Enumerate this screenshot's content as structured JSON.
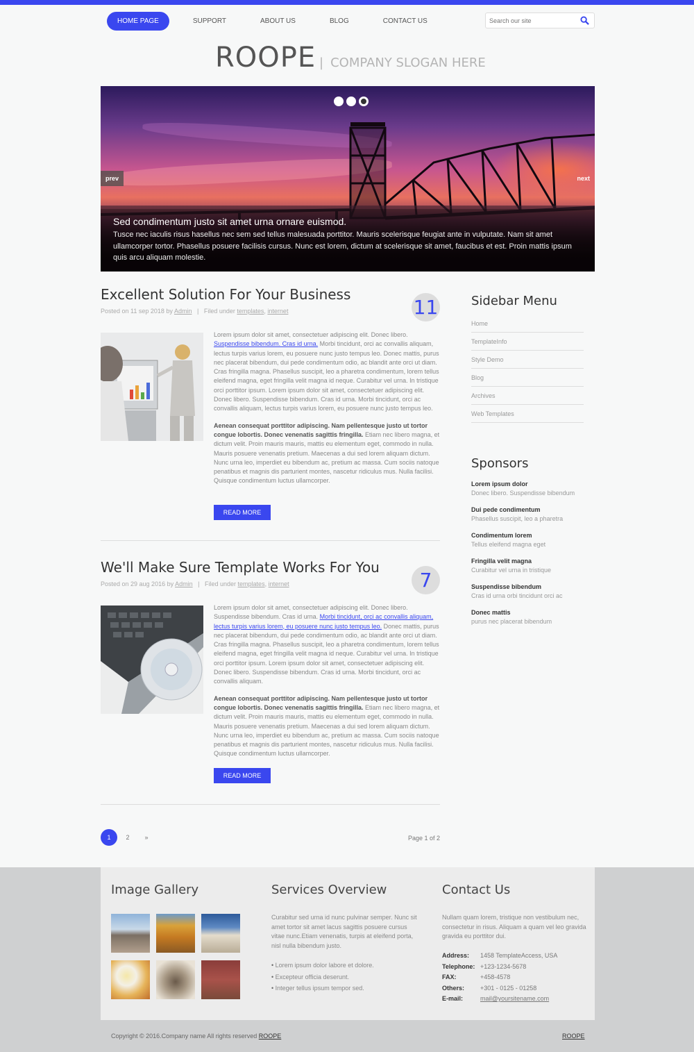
{
  "nav": {
    "items": [
      "HOME PAGE",
      "SUPPORT",
      "ABOUT US",
      "BLOG",
      "CONTACT US"
    ],
    "search_placeholder": "Search our site"
  },
  "header": {
    "logo": "ROOPE",
    "slogan": "COMPANY SLOGAN HERE"
  },
  "slider": {
    "prev": "prev",
    "next": "next",
    "caption_title": "Sed condimentum justo sit amet urna ornare euismod.",
    "caption_text": "Tusce nec iaculis risus hasellus nec sem sed tellus malesuada porttitor. Mauris scelerisque feugiat ante in vulputate. Nam sit amet ullamcorper tortor. Phasellus posuere facilisis cursus. Nunc est lorem, dictum at scelerisque sit amet, faucibus et est. Proin mattis ipsum quis arcu aliquam molestie."
  },
  "articles": [
    {
      "title": "Excellent Solution For Your Business",
      "count": "11",
      "posted": "Posted on 11 sep 2018 by",
      "author": "Admin",
      "filed": "Filed under",
      "tag1": "templates",
      "tag2": "internet",
      "p1a": "Lorem ipsum dolor sit amet, consectetuer adipiscing elit. Donec libero.",
      "p1link": "Suspendisse bibendum. Cras id urna.",
      "p1b": " Morbi tincidunt, orci ac convallis aliquam, lectus turpis varius lorem, eu posuere nunc justo tempus leo. Donec mattis, purus nec placerat bibendum, dui pede condimentum odio, ac blandit ante orci ut diam. Cras fringilla magna. Phasellus suscipit, leo a pharetra condimentum, lorem tellus eleifend magna, eget fringilla velit magna id neque. Curabitur vel urna. In tristique orci porttitor ipsum. Lorem ipsum dolor sit amet, consectetuer adipiscing elit. Donec libero. Suspendisse bibendum. Cras id urna. Morbi tincidunt, orci ac convallis aliquam, lectus turpis varius lorem, eu posuere nunc justo tempus leo.",
      "p2bold": "Aenean consequat porttitor adipiscing. Nam pellentesque justo ut tortor congue lobortis. Donec venenatis sagittis fringilla.",
      "p2": " Etiam nec libero magna, et dictum velit. Proin mauris mauris, mattis eu elementum eget, commodo in nulla. Mauris posuere venenatis pretium. Maecenas a dui sed lorem aliquam dictum. Nunc urna leo, imperdiet eu bibendum ac, pretium ac massa. Cum sociis natoque penatibus et magnis dis parturient montes, nascetur ridiculus mus. Nulla facilisi. Quisque condimentum luctus ullamcorper.",
      "read_more": "READ MORE"
    },
    {
      "title": "We'll Make Sure Template Works For You",
      "count": "7",
      "posted": "Posted on 29 aug 2016 by",
      "author": "Admin",
      "filed": "Filed under",
      "tag1": "templates",
      "tag2": "internet",
      "p1a": "Lorem ipsum dolor sit amet, consectetuer adipiscing elit. Donec libero. Suspendisse bibendum. Cras id urna. ",
      "p1link": "Morbi tincidunt, orci ac convallis aliquam, lectus turpis varius lorem, eu posuere nunc justo tempus leo.",
      "p1b": " Donec mattis, purus nec placerat bibendum, dui pede condimentum odio, ac blandit ante orci ut diam. Cras fringilla magna. Phasellus suscipit, leo a pharetra condimentum, lorem tellus eleifend magna, eget fringilla velit magna id neque. Curabitur vel urna. In tristique orci porttitor ipsum. Lorem ipsum dolor sit amet, consectetuer adipiscing elit. Donec libero. Suspendisse bibendum. Cras id urna. Morbi tincidunt, orci ac convallis aliquam.",
      "p2bold": "Aenean consequat porttitor adipiscing. Nam pellentesque justo ut tortor congue lobortis. Donec venenatis sagittis fringilla.",
      "p2": " Etiam nec libero magna, et dictum velit. Proin mauris mauris, mattis eu elementum eget, commodo in nulla. Mauris posuere venenatis pretium. Maecenas a dui sed lorem aliquam dictum. Nunc urna leo, imperdiet eu bibendum ac, pretium ac massa. Cum sociis natoque penatibus et magnis dis parturient montes, nascetur ridiculus mus. Nulla facilisi. Quisque condimentum luctus ullamcorper.",
      "read_more": "READ MORE"
    }
  ],
  "sidebar": {
    "menu_title": "Sidebar Menu",
    "menu": [
      "Home",
      "TemplateInfo",
      "Style Demo",
      "Blog",
      "Archives",
      "Web Templates"
    ],
    "sponsors_title": "Sponsors",
    "sponsors": [
      {
        "name": "Lorem ipsum dolor",
        "desc": "Donec libero. Suspendisse bibendum"
      },
      {
        "name": "Dui pede condimentum",
        "desc": "Phasellus suscipit, leo a pharetra"
      },
      {
        "name": "Condimentum lorem",
        "desc": "Tellus eleifend magna eget"
      },
      {
        "name": "Fringilla velit magna",
        "desc": "Curabitur vel urna in tristique"
      },
      {
        "name": "Suspendisse bibendum",
        "desc": "Cras id urna orbi tincidunt orci ac"
      },
      {
        "name": "Donec mattis",
        "desc": "purus nec placerat bibendum"
      }
    ]
  },
  "pagination": {
    "pages": [
      "1",
      "2",
      "»"
    ],
    "page_of": "Page 1 of 2"
  },
  "footer": {
    "gallery_title": "Image Gallery",
    "services_title": "Services Overview",
    "services_text": "Curabitur sed urna id nunc pulvinar semper. Nunc sit amet tortor sit amet lacus sagittis posuere cursus vitae nunc.Etiam venenatis, turpis at eleifend porta, nisl nulla bibendum justo.",
    "services_list": [
      "Lorem ipsum dolor labore et dolore.",
      "Excepteur officia deserunt.",
      "Integer tellus ipsum tempor sed."
    ],
    "contact_title": "Contact Us",
    "contact_text": "Nullam quam lorem, tristique non vestibulum nec, consectetur in risus. Aliquam a quam vel leo gravida gravida eu porttitor dui.",
    "contact": [
      {
        "k": "Address:",
        "v": "1458 TemplateAccess, USA"
      },
      {
        "k": "Telephone:",
        "v": "+123-1234-5678"
      },
      {
        "k": "FAX:",
        "v": "+458-4578"
      },
      {
        "k": "Others:",
        "v": "+301 - 0125 - 01258"
      },
      {
        "k": "E-mail:",
        "v": "mail@yoursitename.com"
      }
    ],
    "copyright": "Copyright © 2016.Company name All rights reserved",
    "copyright_link": "ROOPE",
    "brand": "ROOPE"
  },
  "colors": {
    "accent": "#3a47ef"
  }
}
